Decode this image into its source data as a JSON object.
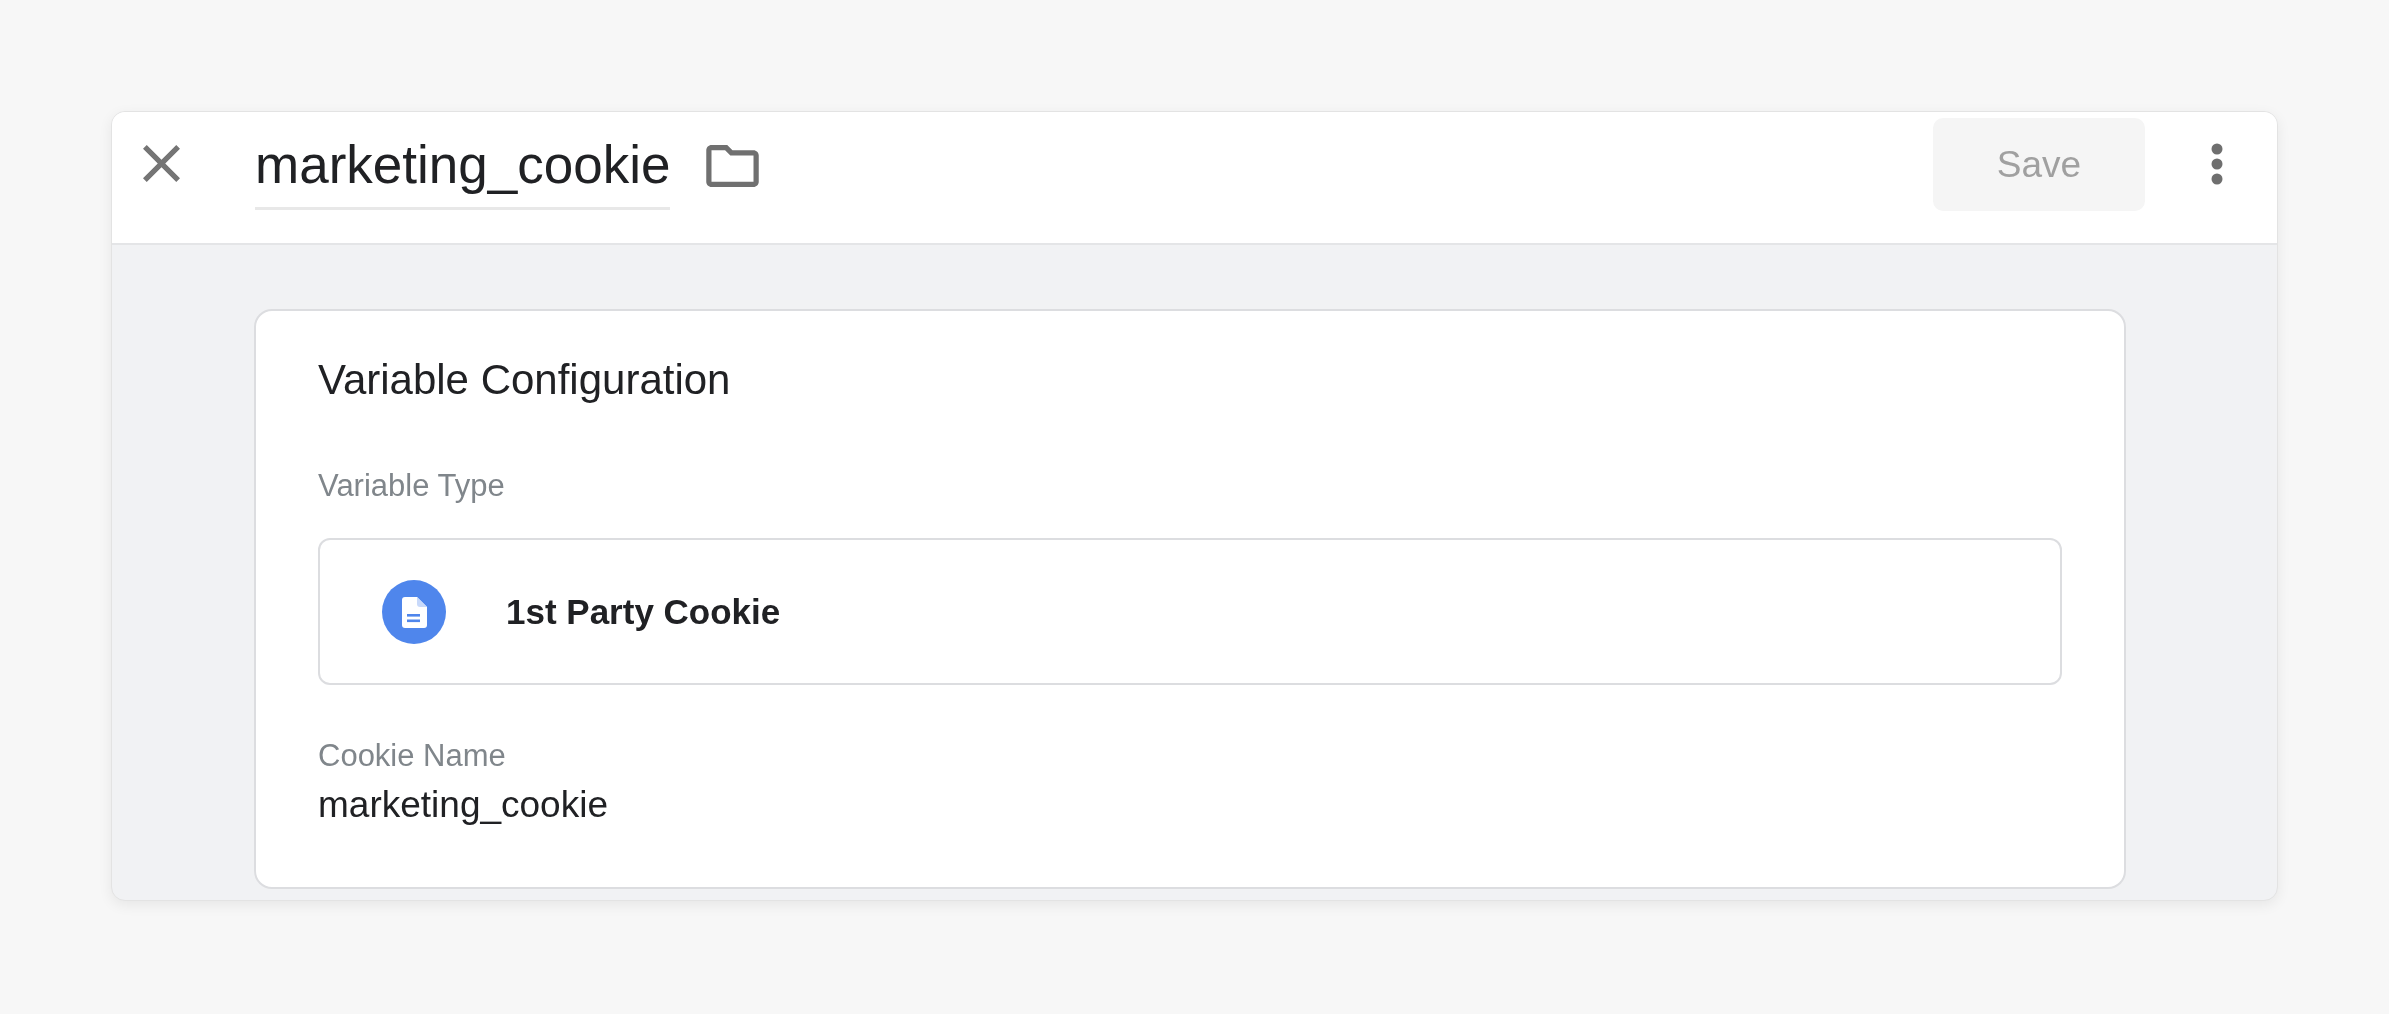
{
  "header": {
    "title": "marketing_cookie",
    "save_button": {
      "label": "Save",
      "disabled": true
    }
  },
  "variable_configuration": {
    "title": "Variable Configuration",
    "variable_type": {
      "label": "Variable Type",
      "value": "1st Party Cookie"
    },
    "cookie_name": {
      "label": "Cookie Name",
      "value": "marketing_cookie"
    }
  }
}
